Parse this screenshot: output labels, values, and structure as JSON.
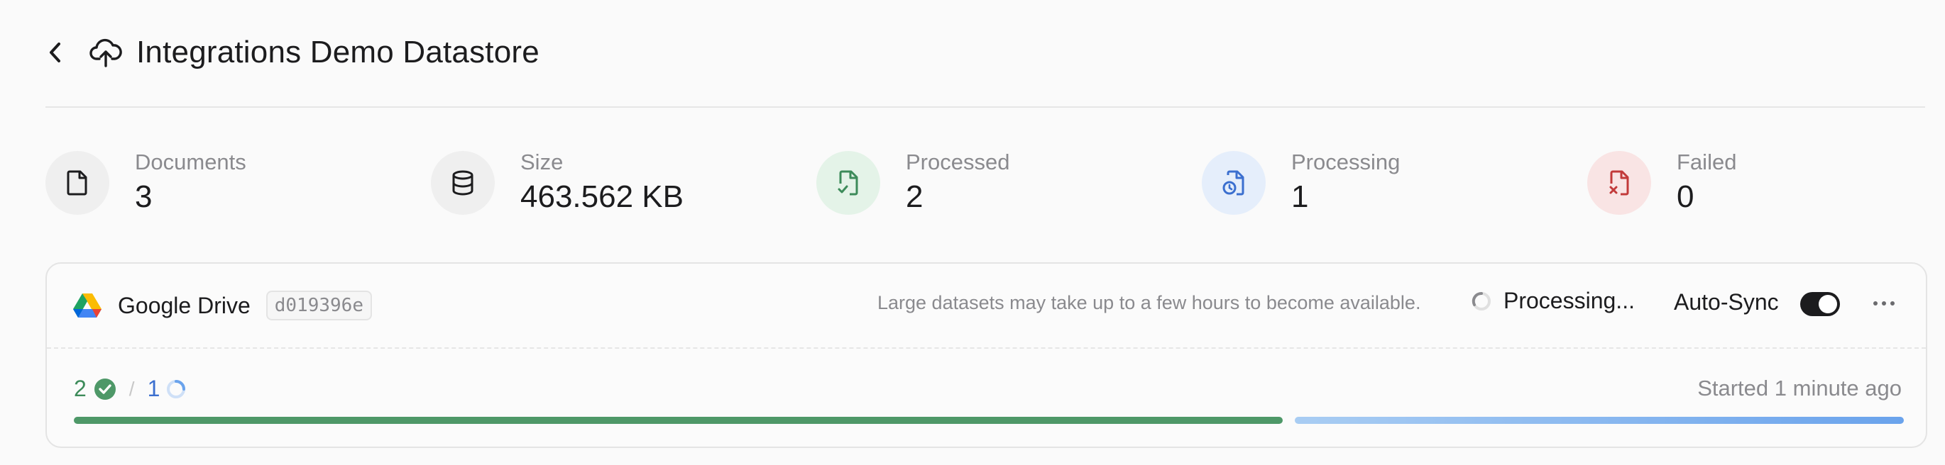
{
  "header": {
    "title": "Integrations Demo Datastore",
    "back_icon": "chevron-left-icon",
    "title_icon": "cloud-upload-icon"
  },
  "stats": [
    {
      "label": "Documents",
      "value": "3",
      "icon": "file-icon",
      "bg": "#efefef",
      "color": "#1c1c1e"
    },
    {
      "label": "Size",
      "value": "463.562 KB",
      "icon": "database-icon",
      "bg": "#efefef",
      "color": "#1c1c1e"
    },
    {
      "label": "Processed",
      "value": "2",
      "icon": "file-check-icon",
      "bg": "#e4f3e8",
      "color": "#3d8b5a"
    },
    {
      "label": "Processing",
      "value": "1",
      "icon": "file-clock-icon",
      "bg": "#e5eefb",
      "color": "#3b6fcf"
    },
    {
      "label": "Failed",
      "value": "0",
      "icon": "file-x-icon",
      "bg": "#f9e4e4",
      "color": "#c23a3a"
    }
  ],
  "source": {
    "name": "Google Drive",
    "id": "d019396e",
    "notice": "Large datasets may take up to a few hours to become available.",
    "status": "Processing...",
    "autosync_label": "Auto-Sync",
    "autosync_on": true,
    "processed_count": "2",
    "separator": "/",
    "processing_count": "1",
    "started": "Started 1 minute ago",
    "progress": {
      "processed_fraction": 0.667,
      "processing_fraction": 0.333
    },
    "colors": {
      "processed": "#4e9868",
      "processing": "#6aa3ec"
    }
  }
}
